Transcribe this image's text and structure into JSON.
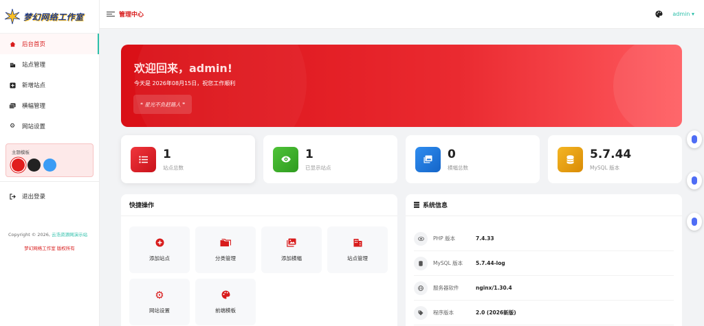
{
  "brand": {
    "logo_text": "梦幻网络工作室"
  },
  "sidebar": {
    "items": [
      {
        "label": "后台首页",
        "icon": "home-icon"
      },
      {
        "label": "站点管理",
        "icon": "building-icon"
      },
      {
        "label": "新增站点",
        "icon": "plus-square-icon"
      },
      {
        "label": "横幅管理",
        "icon": "images-icon"
      },
      {
        "label": "网站设置",
        "icon": "gear-icon"
      }
    ],
    "theme_label": "主题模板",
    "theme_colors": [
      "#e11d1d",
      "#222222",
      "#3b9cf5"
    ],
    "logout": "退出登录",
    "copyright_prefix": "Copyright © 2026,",
    "copyright_link": "云浩资源网演示站",
    "copyright_brand": "梦幻网络工作室 版权所有"
  },
  "topbar": {
    "title": "管理中心",
    "user": "admin ▾"
  },
  "banner": {
    "heading": "欢迎回来，admin!",
    "subtitle": "今天是 2026年08月15日，祝您工作顺利",
    "quote": "❝ 星光不负赶路人 ❞"
  },
  "stats": [
    {
      "value": "1",
      "label": "站点总数",
      "color": "#e3242b"
    },
    {
      "value": "1",
      "label": "已显示站点",
      "color": "#3cab2a"
    },
    {
      "value": "0",
      "label": "横幅总数",
      "color": "#1f7ae0"
    },
    {
      "value": "5.7.44",
      "label": "MySQL 版本",
      "color": "#e8a00c"
    }
  ],
  "quick": {
    "title": "快捷操作",
    "items": [
      {
        "label": "添加站点",
        "icon": "plus-circle-icon"
      },
      {
        "label": "分类管理",
        "icon": "folder-icon"
      },
      {
        "label": "添加横幅",
        "icon": "image-icon"
      },
      {
        "label": "站点管理",
        "icon": "building-icon"
      },
      {
        "label": "网站设置",
        "icon": "gear-icon"
      },
      {
        "label": "前端模板",
        "icon": "palette-icon"
      }
    ]
  },
  "sysinfo": {
    "title": "系统信息",
    "rows": [
      {
        "key": "PHP 版本",
        "value": "7.4.33"
      },
      {
        "key": "MySQL 版本",
        "value": "5.7.44-log"
      },
      {
        "key": "服务器软件",
        "value": "nginx/1.30.4"
      },
      {
        "key": "程序版本",
        "value": "2.0 (2026新版)"
      }
    ]
  }
}
